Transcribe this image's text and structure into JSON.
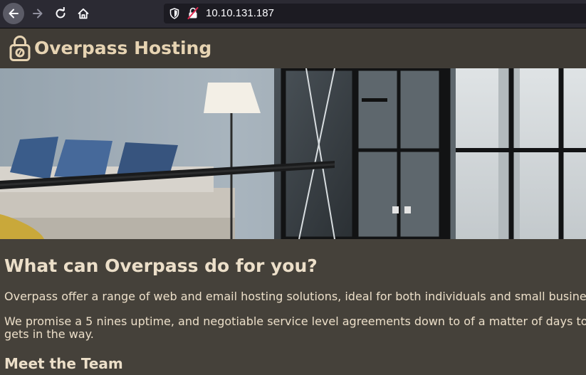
{
  "browser": {
    "url": "10.10.131.187",
    "icons": {
      "back": "arrow-left-icon",
      "forward": "arrow-right-icon",
      "reload": "reload-icon",
      "home": "home-icon",
      "shield": "tracking-shield-icon",
      "insecure": "insecure-lock-icon"
    }
  },
  "site": {
    "title": "Overpass Hosting",
    "logo_icon": "padlock-icon",
    "heading": "What can Overpass do for you?",
    "paragraph1": "Overpass offer a range of web and email hosting solutions, ideal for both individuals and small busine",
    "paragraph2_line1": "We promise a 5 nines uptime, and negotiable service level agreements down to of a matter of days to",
    "paragraph2_line2": "gets in the way.",
    "team_heading": "Meet the Team"
  },
  "colors": {
    "browser_toolbar": "#2b2a33",
    "urlbar": "#1c1b22",
    "page_background": "#45413a",
    "header_background": "#3f3b35",
    "title_text": "#e6d3b2",
    "body_text": "#ecdfc9"
  }
}
